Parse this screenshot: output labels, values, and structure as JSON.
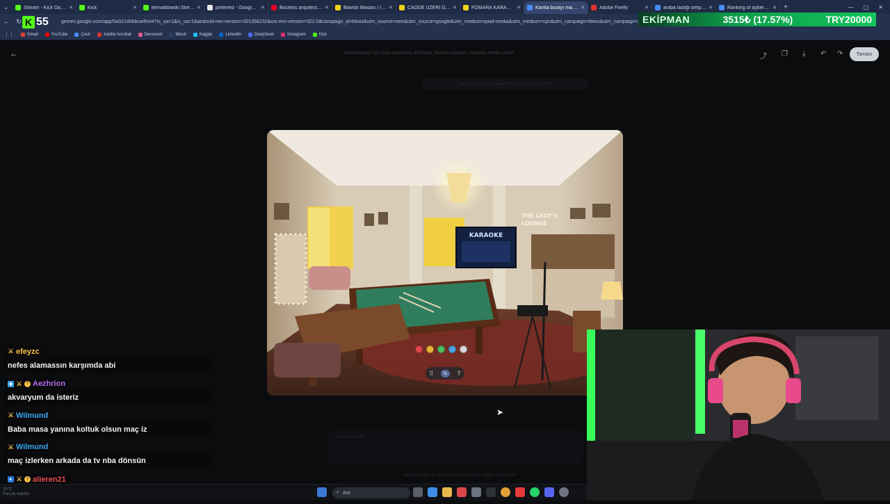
{
  "browser": {
    "tabs": [
      {
        "label": "Stream - Kick Dashbo...",
        "color": "#53fc18",
        "active": false
      },
      {
        "label": "Kick",
        "color": "#53fc18",
        "active": false
      },
      {
        "label": "kemaldowski Stream",
        "color": "#53fc18",
        "active": false
      },
      {
        "label": "pinterest - Google'da a",
        "color": "#e6e6e6",
        "active": false
      },
      {
        "label": "Bocetos arquitectónic",
        "color": "#e60023",
        "active": false
      },
      {
        "label": "Bilardo Masası | İKASA",
        "color": "#f3d21b",
        "active": false
      },
      {
        "label": "CADDE ÜZERİ GENİŞ K",
        "color": "#f3d21b",
        "active": false
      },
      {
        "label": "FOMARA KARAKAŞGİL",
        "color": "#f3d21b",
        "active": false
      },
      {
        "label": "Kanka burayı mam cav",
        "color": "#4a8cff",
        "active": true
      },
      {
        "label": "Adobe Firefly",
        "color": "#e0312b",
        "active": false
      },
      {
        "label": "araba lastiği sehpa - ",
        "color": "#4a8cff",
        "active": false
      },
      {
        "label": "Ranking of ayberkurat",
        "color": "#4a8cff",
        "active": false
      }
    ],
    "url": "gemini.google.com/app/5a32140bbca4fce4?is_sa=1&is_sa=1&android-min-version=301356232&ios-min-version=322.0&campaign_id=bkws&utm_source=sem&utm_source=google&utm_medium=paid-media&utm_medium=cpc&utm_campaign=bkws&utm_campaign=2024",
    "bookmarks": [
      {
        "label": "Gmail",
        "color": "#ea4335"
      },
      {
        "label": "YouTube",
        "color": "#ff0000"
      },
      {
        "label": "Çevir",
        "color": "#4a8cff"
      },
      {
        "label": "Adobe Acrobat",
        "color": "#e0312b"
      },
      {
        "label": "Densonet",
        "color": "#e05a8a"
      },
      {
        "label": "Mixuil",
        "color": "#2f3e66"
      },
      {
        "label": "Kaggle",
        "color": "#20beff"
      },
      {
        "label": "LinkedIn",
        "color": "#0a66c2"
      },
      {
        "label": "DeepSeek",
        "color": "#4d6bfe"
      },
      {
        "label": "Instagram",
        "color": "#e1306c"
      },
      {
        "label": "Kick",
        "color": "#53fc18"
      }
    ]
  },
  "overlay": {
    "kick_logo": "K",
    "kick_count": "55",
    "banner_name": "EKİPMAN",
    "banner_value": "3515₺ (17.57%)",
    "banner_goal": "TRY20000"
  },
  "app": {
    "title": "Kanka burayı bir oyun salonuna dönüştür, bilardo masası, karaoke ekranı olsun",
    "done_label": "Tamam",
    "prompt_hint": "Kanka burayı mam cavalu bir oyun salonu yapalım",
    "input_hint": "Gemini'a sorun",
    "disclaimer": "Gemini, kişiler de dahil olmak üzere hatalı bilgiler gösterebilir.",
    "palette": [
      "#e0444a",
      "#e8b53a",
      "#4cbf5e",
      "#4aa3e0",
      "#d9d9d9"
    ],
    "image_texts": {
      "karaoke": "KARAOKE",
      "lounge_1": "THE LADY'S",
      "lounge_2": "LOUNGE"
    }
  },
  "chat": [
    {
      "user": "efeyzc",
      "color": "#f6c143",
      "badges": [
        "sword"
      ],
      "text": "nefes alamassın karşımda abi"
    },
    {
      "user": "Aezhrion",
      "color": "#b36af0",
      "badges": [
        "cube",
        "sword",
        "coin"
      ],
      "text": "akvaryum da isteriz"
    },
    {
      "user": "Wilmund",
      "color": "#3aa7f0",
      "badges": [
        "sword"
      ],
      "text": "Baba masa yanına koltuk olsun maç iz"
    },
    {
      "user": "Wilmund",
      "color": "#3aa7f0",
      "badges": [
        "sword"
      ],
      "text": "maç izlerken arkada da tv nba dönsün"
    },
    {
      "user": "alieren21",
      "color": "#e84a4a",
      "badges": [
        "sq",
        "sword",
        "coin"
      ],
      "text": "gay"
    }
  ],
  "taskbar": {
    "search_label": "Ara",
    "status_line1": "15°C",
    "status_line2": "Parçalı bulutlu"
  }
}
